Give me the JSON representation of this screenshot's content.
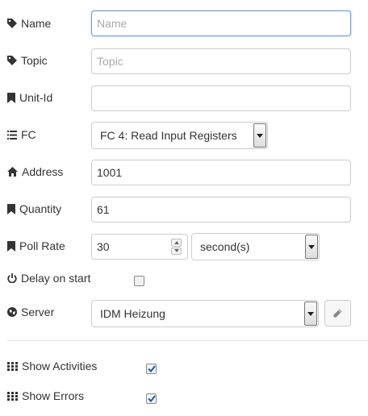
{
  "name": {
    "label": "Name",
    "value": "",
    "placeholder": "Name"
  },
  "topic": {
    "label": "Topic",
    "value": "",
    "placeholder": "Topic"
  },
  "unit_id": {
    "label": "Unit-Id",
    "value": ""
  },
  "fc": {
    "label": "FC",
    "selected": "FC 4: Read Input Registers"
  },
  "address": {
    "label": "Address",
    "value": "1001"
  },
  "quantity": {
    "label": "Quantity",
    "value": "61"
  },
  "poll_rate": {
    "label": "Poll Rate",
    "value": "30",
    "unit": "second(s)"
  },
  "delay_on_start": {
    "label": "Delay on start",
    "checked": false
  },
  "server": {
    "label": "Server",
    "selected": "IDM Heizung",
    "edit_icon": "pencil-icon"
  },
  "show_activities": {
    "label": "Show Activities",
    "checked": true
  },
  "show_errors": {
    "label": "Show Errors",
    "checked": true
  },
  "colors": {
    "focus_border": "#6e9fd6",
    "check": "#1f5aa6"
  }
}
